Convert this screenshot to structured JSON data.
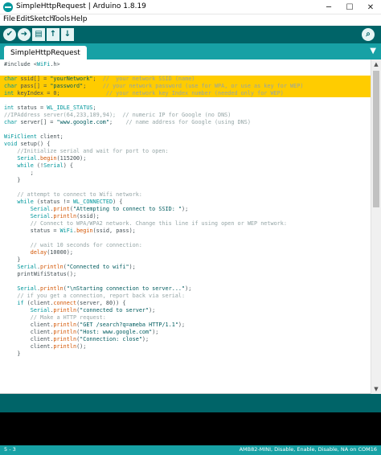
{
  "window": {
    "title": "SimpleHttpRequest | Arduino 1.8.19",
    "minimize": "─",
    "maximize": "☐",
    "close": "✕"
  },
  "menu": {
    "items": [
      "File",
      "Edit",
      "Sketch",
      "Tools",
      "Help"
    ]
  },
  "toolbar": {
    "verify_icon": "✔",
    "upload_icon": "➜",
    "new_icon": "▤",
    "open_icon": "↑",
    "save_icon": "↓",
    "monitor_icon": "⌕"
  },
  "tabs": {
    "active": "SimpleHttpRequest",
    "menu_arrow": "▼"
  },
  "colors": {
    "toolbar": "#006468",
    "tabstrip": "#17a1a5",
    "highlight": "#ffcc00",
    "keyword": "#00979c",
    "function": "#d35400",
    "string": "#005c5f",
    "comment": "#95a5a6"
  },
  "code": [
    "#include <WiFi.h>",
    "",
    "char ssid[] = \"yourNetwork\";  //  your network SSID (name)",
    "char pass[] = \"password\";     // your network password (use for WPA, or use as key for WEP)",
    "int keyIndex = 0;              // your network key Index number (needed only for WEP)",
    "",
    "int status = WL_IDLE_STATUS;",
    "//IPAddress server(64,233,189,94);  // numeric IP for Google (no DNS)",
    "char server[] = \"www.google.com\";    // name address for Google (using DNS)",
    "",
    "WiFiClient client;",
    "void setup() {",
    "    //Initialize serial and wait for port to open:",
    "    Serial.begin(115200);",
    "    while (!Serial) {",
    "        ;",
    "    }",
    "",
    "    // attempt to connect to Wifi network:",
    "    while (status != WL_CONNECTED) {",
    "        Serial.print(\"Attempting to connect to SSID: \");",
    "        Serial.println(ssid);",
    "        // Connect to WPA/WPA2 network. Change this line if using open or WEP network:",
    "        status = WiFi.begin(ssid, pass);",
    "",
    "        // wait 10 seconds for connection:",
    "        delay(10000);",
    "    }",
    "    Serial.println(\"Connected to wifi\");",
    "    printWifiStatus();",
    "",
    "    Serial.println(\"\\nStarting connection to server...\");",
    "    // if you get a connection, report back via serial:",
    "    if (client.connect(server, 80)) {",
    "        Serial.println(\"connected to server\");",
    "        // Make a HTTP request:",
    "        client.println(\"GET /search?q=ameba HTTP/1.1\");",
    "        client.println(\"Host: www.google.com\");",
    "        client.println(\"Connection: close\");",
    "        client.println();",
    "    }"
  ],
  "status": {
    "line": "5 - 3",
    "board": "AMB82-MINI, Disable, Enable, Disable, NA on COM16"
  }
}
